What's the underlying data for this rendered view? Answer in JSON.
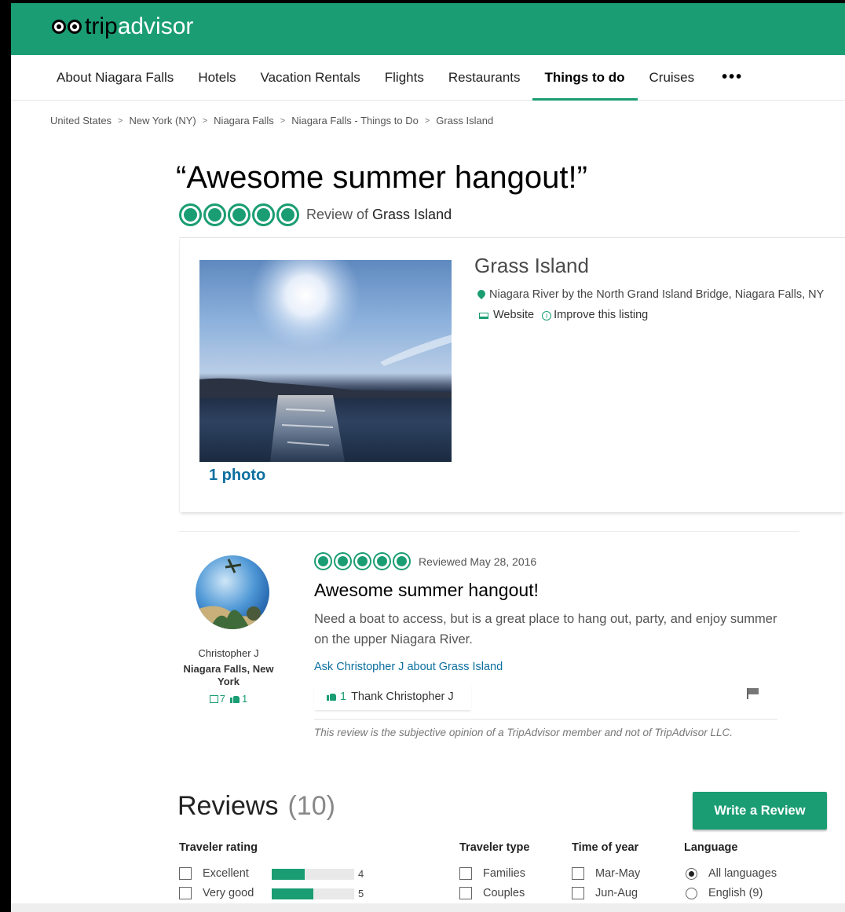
{
  "brand": {
    "logo_trip": "trip",
    "logo_advisor": "advisor",
    "color": "#1a9d72"
  },
  "nav": {
    "items": [
      "About Niagara Falls",
      "Hotels",
      "Vacation Rentals",
      "Flights",
      "Restaurants",
      "Things to do",
      "Cruises"
    ],
    "active": "Things to do",
    "more": "•••"
  },
  "breadcrumb": [
    "United States",
    "New York (NY)",
    "Niagara Falls",
    "Niagara Falls - Things to Do",
    "Grass Island"
  ],
  "review_page": {
    "title": "“Awesome summer hangout!”",
    "rating": 5,
    "review_of_prefix": "Review of ",
    "review_of_place": "Grass Island"
  },
  "listing": {
    "photo_count": "1 photo",
    "name": "Grass Island",
    "address": "Niagara River by the North Grand Island Bridge, Niagara Falls, NY",
    "website": "Website",
    "improve": "Improve this listing"
  },
  "review": {
    "reviewer_name": "Christopher J",
    "reviewer_location": "Niagara Falls, New York",
    "reviews_count": "7",
    "helpful_count": "1",
    "rating": 5,
    "date": "Reviewed May 28, 2016",
    "title": "Awesome summer hangout!",
    "body": "Need a boat to access, but is a great place to hang out, party, and enjoy summer on the upper Niagara River.",
    "ask": "Ask Christopher J about Grass Island",
    "thank_count": "1",
    "thank_label": "Thank Christopher J",
    "disclaimer": "This review is the subjective opinion of a TripAdvisor member and not of TripAdvisor LLC."
  },
  "reviews_section": {
    "heading": "Reviews",
    "count": "(10)",
    "write_button": "Write a Review",
    "filters": {
      "traveler_rating": {
        "label": "Traveler rating",
        "items": [
          {
            "label": "Excellent",
            "count": 4,
            "fraction": 0.4
          },
          {
            "label": "Very good",
            "count": 5,
            "fraction": 0.5
          }
        ]
      },
      "traveler_type": {
        "label": "Traveler type",
        "items": [
          "Families",
          "Couples"
        ]
      },
      "time_of_year": {
        "label": "Time of year",
        "items": [
          "Mar-May",
          "Jun-Aug"
        ]
      },
      "language": {
        "label": "Language",
        "items": [
          "All languages",
          "English (9)"
        ],
        "selected": "All languages"
      }
    }
  }
}
